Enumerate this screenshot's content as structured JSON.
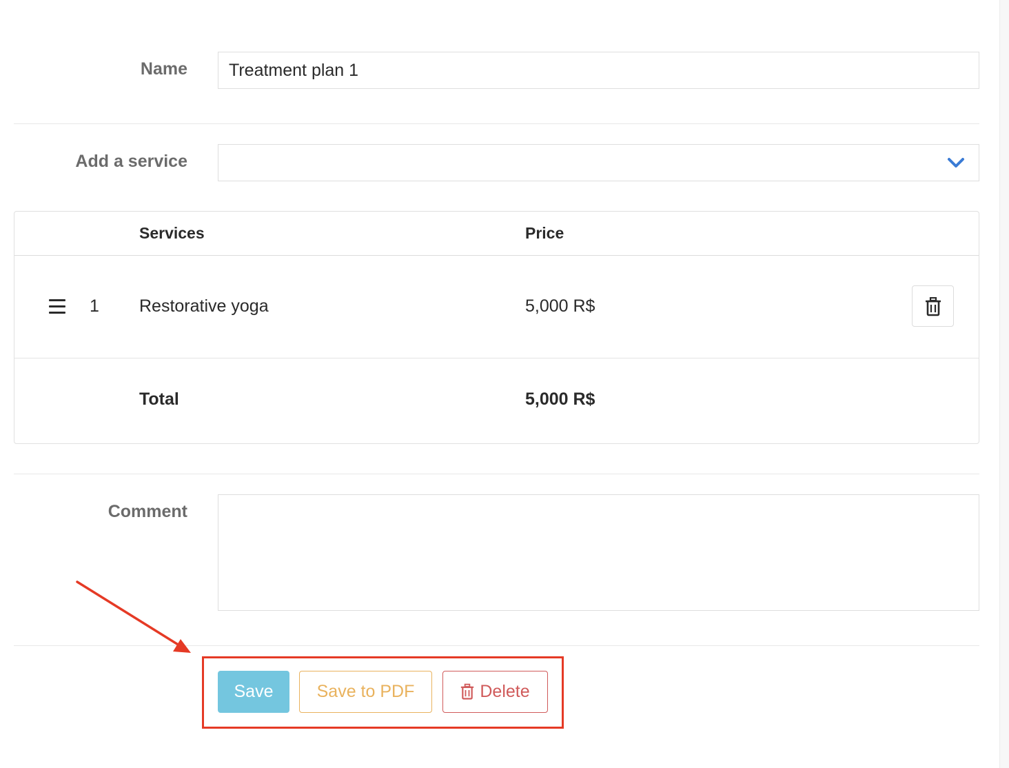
{
  "form": {
    "name_label": "Name",
    "name_value": "Treatment plan 1",
    "service_label": "Add a service",
    "service_value": "",
    "comment_label": "Comment",
    "comment_value": ""
  },
  "table": {
    "columns": [
      "Services",
      "Price"
    ],
    "rows": [
      {
        "index": "1",
        "service": "Restorative yoga",
        "price": "5,000 R$"
      }
    ],
    "total_label": "Total",
    "total_value": "5,000 R$"
  },
  "actions": {
    "save_label": "Save",
    "pdf_label": "Save to PDF",
    "delete_label": "Delete"
  },
  "icons": {
    "dropdown": "chevron-down-icon",
    "drag": "drag-handle-icon",
    "row_delete": "trash-icon",
    "button_delete": "trash-icon"
  },
  "colors": {
    "save_button": "#74c6df",
    "pdf_button": "#e9b25d",
    "delete_button": "#d05a5a",
    "chevron": "#3a7bd5",
    "annotation": "#e53a25"
  }
}
